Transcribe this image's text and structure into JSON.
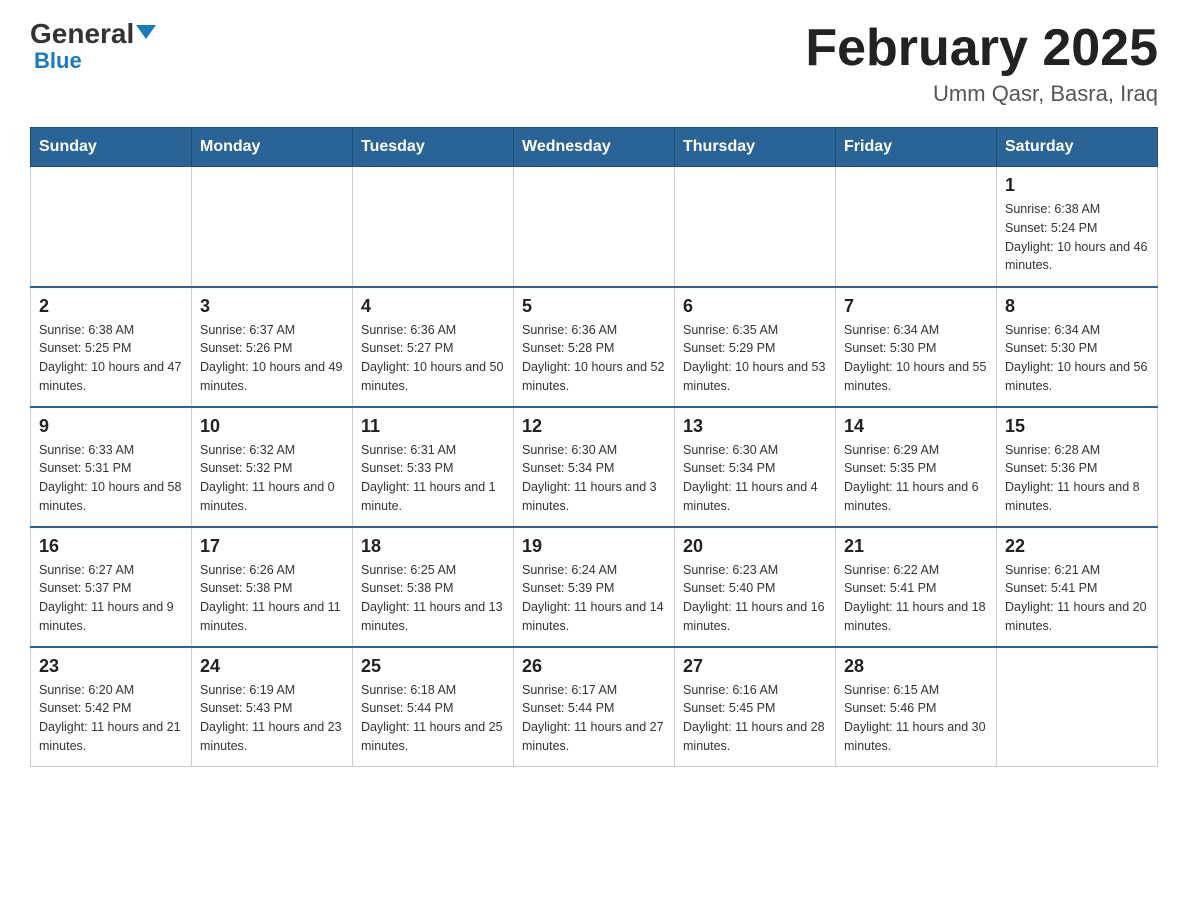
{
  "header": {
    "logo_general": "General",
    "logo_blue": "Blue",
    "main_title": "February 2025",
    "subtitle": "Umm Qasr, Basra, Iraq"
  },
  "days_of_week": [
    "Sunday",
    "Monday",
    "Tuesday",
    "Wednesday",
    "Thursday",
    "Friday",
    "Saturday"
  ],
  "weeks": [
    [
      {
        "day": "",
        "info": ""
      },
      {
        "day": "",
        "info": ""
      },
      {
        "day": "",
        "info": ""
      },
      {
        "day": "",
        "info": ""
      },
      {
        "day": "",
        "info": ""
      },
      {
        "day": "",
        "info": ""
      },
      {
        "day": "1",
        "info": "Sunrise: 6:38 AM\nSunset: 5:24 PM\nDaylight: 10 hours and 46 minutes."
      }
    ],
    [
      {
        "day": "2",
        "info": "Sunrise: 6:38 AM\nSunset: 5:25 PM\nDaylight: 10 hours and 47 minutes."
      },
      {
        "day": "3",
        "info": "Sunrise: 6:37 AM\nSunset: 5:26 PM\nDaylight: 10 hours and 49 minutes."
      },
      {
        "day": "4",
        "info": "Sunrise: 6:36 AM\nSunset: 5:27 PM\nDaylight: 10 hours and 50 minutes."
      },
      {
        "day": "5",
        "info": "Sunrise: 6:36 AM\nSunset: 5:28 PM\nDaylight: 10 hours and 52 minutes."
      },
      {
        "day": "6",
        "info": "Sunrise: 6:35 AM\nSunset: 5:29 PM\nDaylight: 10 hours and 53 minutes."
      },
      {
        "day": "7",
        "info": "Sunrise: 6:34 AM\nSunset: 5:30 PM\nDaylight: 10 hours and 55 minutes."
      },
      {
        "day": "8",
        "info": "Sunrise: 6:34 AM\nSunset: 5:30 PM\nDaylight: 10 hours and 56 minutes."
      }
    ],
    [
      {
        "day": "9",
        "info": "Sunrise: 6:33 AM\nSunset: 5:31 PM\nDaylight: 10 hours and 58 minutes."
      },
      {
        "day": "10",
        "info": "Sunrise: 6:32 AM\nSunset: 5:32 PM\nDaylight: 11 hours and 0 minutes."
      },
      {
        "day": "11",
        "info": "Sunrise: 6:31 AM\nSunset: 5:33 PM\nDaylight: 11 hours and 1 minute."
      },
      {
        "day": "12",
        "info": "Sunrise: 6:30 AM\nSunset: 5:34 PM\nDaylight: 11 hours and 3 minutes."
      },
      {
        "day": "13",
        "info": "Sunrise: 6:30 AM\nSunset: 5:34 PM\nDaylight: 11 hours and 4 minutes."
      },
      {
        "day": "14",
        "info": "Sunrise: 6:29 AM\nSunset: 5:35 PM\nDaylight: 11 hours and 6 minutes."
      },
      {
        "day": "15",
        "info": "Sunrise: 6:28 AM\nSunset: 5:36 PM\nDaylight: 11 hours and 8 minutes."
      }
    ],
    [
      {
        "day": "16",
        "info": "Sunrise: 6:27 AM\nSunset: 5:37 PM\nDaylight: 11 hours and 9 minutes."
      },
      {
        "day": "17",
        "info": "Sunrise: 6:26 AM\nSunset: 5:38 PM\nDaylight: 11 hours and 11 minutes."
      },
      {
        "day": "18",
        "info": "Sunrise: 6:25 AM\nSunset: 5:38 PM\nDaylight: 11 hours and 13 minutes."
      },
      {
        "day": "19",
        "info": "Sunrise: 6:24 AM\nSunset: 5:39 PM\nDaylight: 11 hours and 14 minutes."
      },
      {
        "day": "20",
        "info": "Sunrise: 6:23 AM\nSunset: 5:40 PM\nDaylight: 11 hours and 16 minutes."
      },
      {
        "day": "21",
        "info": "Sunrise: 6:22 AM\nSunset: 5:41 PM\nDaylight: 11 hours and 18 minutes."
      },
      {
        "day": "22",
        "info": "Sunrise: 6:21 AM\nSunset: 5:41 PM\nDaylight: 11 hours and 20 minutes."
      }
    ],
    [
      {
        "day": "23",
        "info": "Sunrise: 6:20 AM\nSunset: 5:42 PM\nDaylight: 11 hours and 21 minutes."
      },
      {
        "day": "24",
        "info": "Sunrise: 6:19 AM\nSunset: 5:43 PM\nDaylight: 11 hours and 23 minutes."
      },
      {
        "day": "25",
        "info": "Sunrise: 6:18 AM\nSunset: 5:44 PM\nDaylight: 11 hours and 25 minutes."
      },
      {
        "day": "26",
        "info": "Sunrise: 6:17 AM\nSunset: 5:44 PM\nDaylight: 11 hours and 27 minutes."
      },
      {
        "day": "27",
        "info": "Sunrise: 6:16 AM\nSunset: 5:45 PM\nDaylight: 11 hours and 28 minutes."
      },
      {
        "day": "28",
        "info": "Sunrise: 6:15 AM\nSunset: 5:46 PM\nDaylight: 11 hours and 30 minutes."
      },
      {
        "day": "",
        "info": ""
      }
    ]
  ]
}
